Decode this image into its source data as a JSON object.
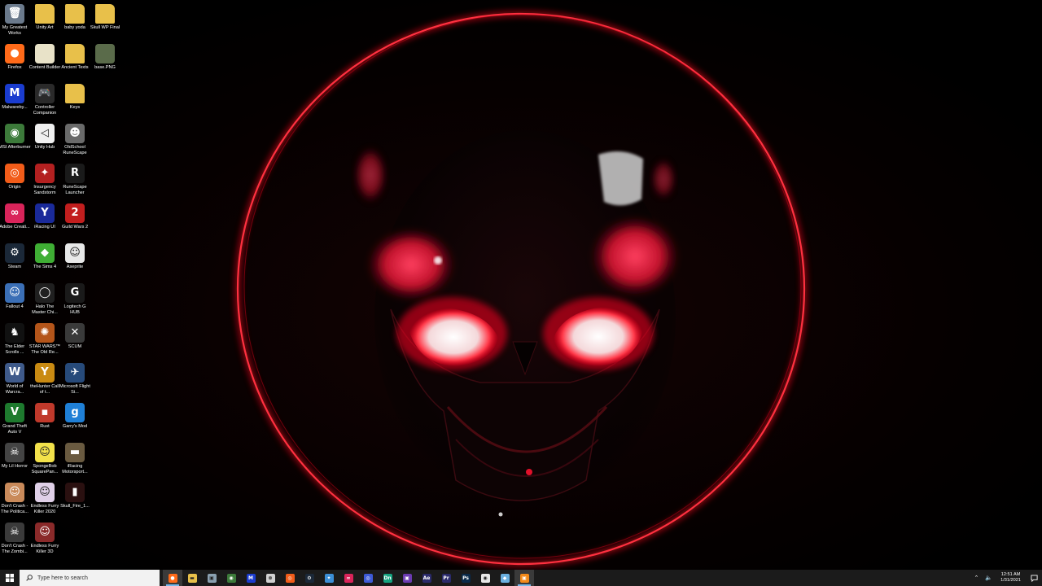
{
  "desktop": {
    "icons": [
      {
        "label": "My Greatest Works",
        "icon": "recycle-bin-icon",
        "glyph": "🗑",
        "color": "#6b7a8c"
      },
      {
        "label": "Unity Art",
        "icon": "folder-icon",
        "glyph": "",
        "color": "#e8c04a"
      },
      {
        "label": "baby yoda",
        "icon": "folder-icon",
        "glyph": "",
        "color": "#e8c04a"
      },
      {
        "label": "Skull WP Final",
        "icon": "folder-icon",
        "glyph": "",
        "color": "#e8c04a"
      },
      {
        "label": "Firefox",
        "icon": "firefox-icon",
        "glyph": "●",
        "color": "#ff6a19"
      },
      {
        "label": "Content Builder",
        "icon": "document-icon",
        "glyph": "",
        "color": "#e8e2c8"
      },
      {
        "label": "Ancient Texts",
        "icon": "folder-icon",
        "glyph": "",
        "color": "#e8c04a"
      },
      {
        "label": "base.PNG",
        "icon": "image-icon",
        "glyph": "",
        "color": "#5a6b4a"
      },
      {
        "label": "Malwareby...",
        "icon": "malwarebytes-icon",
        "glyph": "M",
        "color": "#1a3ccf"
      },
      {
        "label": "Controller Companion",
        "icon": "gamepad-icon",
        "glyph": "🎮",
        "color": "#2a2a2a"
      },
      {
        "label": "Keys",
        "icon": "folder-icon",
        "glyph": "",
        "color": "#e8c04a"
      },
      {
        "label": "MSI Afterburner",
        "icon": "msi-afterburner-icon",
        "glyph": "◉",
        "color": "#3c7a3a"
      },
      {
        "label": "Unity Hub",
        "icon": "unity-icon",
        "glyph": "◁",
        "color": "#f0f0f0"
      },
      {
        "label": "OldSchool RuneScape",
        "icon": "runescape-icon",
        "glyph": "☻",
        "color": "#6a6a6a"
      },
      {
        "label": "Origin",
        "icon": "origin-icon",
        "glyph": "◎",
        "color": "#f25c19"
      },
      {
        "label": "Insurgency Sandstorm",
        "icon": "insurgency-icon",
        "glyph": "✦",
        "color": "#b32020"
      },
      {
        "label": "RuneScape Launcher",
        "icon": "runescape-launcher-icon",
        "glyph": "R",
        "color": "#1a1a1a"
      },
      {
        "label": "Adobe Creati...",
        "icon": "adobe-cc-icon",
        "glyph": "∞",
        "color": "#d9245a"
      },
      {
        "label": "iRacing UI",
        "icon": "iracing-icon",
        "glyph": "Y",
        "color": "#1a2a9a"
      },
      {
        "label": "Guild Wars 2",
        "icon": "guild-wars-icon",
        "glyph": "2",
        "color": "#c21e1e"
      },
      {
        "label": "Steam",
        "icon": "steam-icon",
        "glyph": "⚙",
        "color": "#1b2838"
      },
      {
        "label": "The Sims 4",
        "icon": "sims-icon",
        "glyph": "◆",
        "color": "#3fae34"
      },
      {
        "label": "Aseprite",
        "icon": "aseprite-icon",
        "glyph": "☺",
        "color": "#e8e8e8"
      },
      {
        "label": "Fallout 4",
        "icon": "fallout-icon",
        "glyph": "☺",
        "color": "#3b6fb6"
      },
      {
        "label": "Halo The Master Chi...",
        "icon": "halo-icon",
        "glyph": "◯",
        "color": "#202020"
      },
      {
        "label": "Logitech G HUB",
        "icon": "logitech-icon",
        "glyph": "G",
        "color": "#1a1a1a"
      },
      {
        "label": "The Elder Scrolls ...",
        "icon": "elder-scrolls-icon",
        "glyph": "♞",
        "color": "#111111"
      },
      {
        "label": "STAR WARS™ The Old Re...",
        "icon": "star-wars-icon",
        "glyph": "✺",
        "color": "#b4551a"
      },
      {
        "label": "SCUM",
        "icon": "scum-icon",
        "glyph": "✕",
        "color": "#3a3a3a"
      },
      {
        "label": "World of Warcra...",
        "icon": "wow-icon",
        "glyph": "W",
        "color": "#3f5a8a"
      },
      {
        "label": "theHunter Call of t...",
        "icon": "thehunter-icon",
        "glyph": "Y",
        "color": "#c98a12"
      },
      {
        "label": "Microsoft Flight Si...",
        "icon": "flight-sim-icon",
        "glyph": "✈",
        "color": "#274a7a"
      },
      {
        "label": "Grand Theft Auto V",
        "icon": "gta-icon",
        "glyph": "V",
        "color": "#1e7a2e"
      },
      {
        "label": "Rust",
        "icon": "rust-icon",
        "glyph": "▪",
        "color": "#c0392b"
      },
      {
        "label": "Garry's Mod",
        "icon": "garrys-mod-icon",
        "glyph": "g",
        "color": "#1f7fd6"
      },
      {
        "label": "My Lil Horror",
        "icon": "game-icon",
        "glyph": "☠",
        "color": "#444444"
      },
      {
        "label": "SpongeBob SquarePan...",
        "icon": "spongebob-icon",
        "glyph": "☺",
        "color": "#f2e14a"
      },
      {
        "label": "iRacing Motorsport...",
        "icon": "iracing-sim-icon",
        "glyph": "▬",
        "color": "#6a5a40"
      },
      {
        "label": "Don't Crash - The Politica...",
        "icon": "game-icon",
        "glyph": "☺",
        "color": "#c98a5a"
      },
      {
        "label": "Endless Furry Killer 2020",
        "icon": "game-icon",
        "glyph": "☺",
        "color": "#e0d0e8"
      },
      {
        "label": "Skull_Fire_1...",
        "icon": "video-file-icon",
        "glyph": "▮",
        "color": "#2a1010"
      },
      {
        "label": "Don't Crash - The Zombi...",
        "icon": "game-icon",
        "glyph": "☠",
        "color": "#3a3a3a"
      },
      {
        "label": "Endless Furry Killer 3D",
        "icon": "game-icon",
        "glyph": "☺",
        "color": "#8a2a2a"
      }
    ]
  },
  "taskbar": {
    "start_icon": "windows-start-icon",
    "search_placeholder": "Type here to search",
    "apps": [
      {
        "name": "firefox",
        "icon": "firefox-icon",
        "glyph": "●",
        "color": "#ff6a19",
        "state": "active"
      },
      {
        "name": "file-explorer",
        "icon": "folder-icon",
        "glyph": "▬",
        "color": "#e8c04a",
        "state": ""
      },
      {
        "name": "app-3",
        "icon": "app-icon",
        "glyph": "▣",
        "color": "#8aa0b0",
        "state": ""
      },
      {
        "name": "app-4",
        "icon": "msi-afterburner-icon",
        "glyph": "◉",
        "color": "#3c7a3a",
        "state": ""
      },
      {
        "name": "malwarebytes",
        "icon": "malwarebytes-icon",
        "glyph": "M",
        "color": "#1a3ccf",
        "state": ""
      },
      {
        "name": "xbox",
        "icon": "xbox-icon",
        "glyph": "⊗",
        "color": "#d0d0d0",
        "state": ""
      },
      {
        "name": "origin",
        "icon": "origin-icon",
        "glyph": "◎",
        "color": "#f25c19",
        "state": ""
      },
      {
        "name": "steam",
        "icon": "steam-icon",
        "glyph": "⚙",
        "color": "#1b2838",
        "state": ""
      },
      {
        "name": "app-9",
        "icon": "app-icon",
        "glyph": "✦",
        "color": "#3b8ed6",
        "state": ""
      },
      {
        "name": "adobe-cc",
        "icon": "adobe-cc-icon",
        "glyph": "∞",
        "color": "#d9245a",
        "state": ""
      },
      {
        "name": "app-11",
        "icon": "app-icon",
        "glyph": "◎",
        "color": "#3d5ad6",
        "state": ""
      },
      {
        "name": "dimension",
        "icon": "dimension-icon",
        "glyph": "Dn",
        "color": "#14a37f",
        "state": ""
      },
      {
        "name": "app-13",
        "icon": "app-icon",
        "glyph": "▣",
        "color": "#6a3ab0",
        "state": ""
      },
      {
        "name": "after-effects",
        "icon": "after-effects-icon",
        "glyph": "Ae",
        "color": "#2a2a6a",
        "state": ""
      },
      {
        "name": "premiere",
        "icon": "premiere-icon",
        "glyph": "Pr",
        "color": "#2a2a6a",
        "state": ""
      },
      {
        "name": "photoshop",
        "icon": "photoshop-icon",
        "glyph": "Ps",
        "color": "#0a2a4a",
        "state": ""
      },
      {
        "name": "obs",
        "icon": "obs-icon",
        "glyph": "◉",
        "color": "#e8e8e8",
        "state": ""
      },
      {
        "name": "app-18",
        "icon": "app-icon",
        "glyph": "◆",
        "color": "#6ab0e0",
        "state": ""
      },
      {
        "name": "app-19",
        "icon": "app-icon",
        "glyph": "▣",
        "color": "#f28a1a",
        "state": "active"
      }
    ],
    "tray": {
      "chevron_icon": "chevron-up-icon",
      "volume_icon": "volume-icon",
      "time": "12:51 AM",
      "date": "1/31/2021",
      "notification_icon": "notification-icon"
    }
  }
}
